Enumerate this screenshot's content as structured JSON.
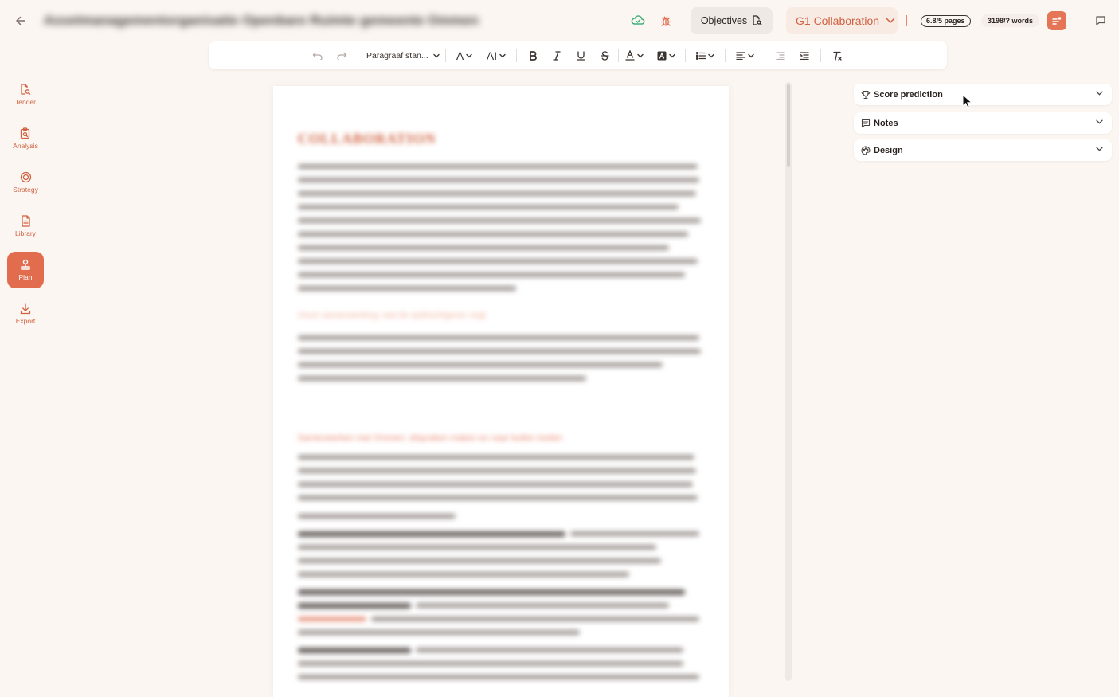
{
  "topbar": {
    "title": "Assetmanagementorganisatie Openbare Ruimte gemeente Ommen",
    "objectives_label": "Objectives",
    "section_label": "G1 Collaboration",
    "pages_badge": "6.8/5 pages",
    "words_badge": "3198/? words"
  },
  "toolbar": {
    "paragraph_style": "Paragraaf stan...",
    "font_size_glyph": "A",
    "line_height_glyph": "AI"
  },
  "nav": {
    "items": [
      {
        "label": "Tender",
        "icon": "tender-icon"
      },
      {
        "label": "Analysis",
        "icon": "analysis-icon"
      },
      {
        "label": "Strategy",
        "icon": "target-icon"
      },
      {
        "label": "Library",
        "icon": "document-icon"
      },
      {
        "label": "Plan",
        "icon": "plan-icon",
        "active": true
      },
      {
        "label": "Export",
        "icon": "download-icon"
      }
    ]
  },
  "document": {
    "heading": "COLLABORATION",
    "subheading_1": "Onze samenwerking: wat de opdrachtgever zegt",
    "subheading_2": "Samenwerken met Ommen: afspraken maken en naar buiten treden"
  },
  "panel": {
    "items": [
      {
        "title": "Score prediction",
        "icon": "trophy-icon"
      },
      {
        "title": "Notes",
        "icon": "notes-icon"
      },
      {
        "title": "Design",
        "icon": "palette-icon"
      }
    ]
  },
  "colors": {
    "accent": "#e16d4e",
    "accent_text": "#d0613f",
    "background": "#fbf6f2",
    "success": "#3fae7a"
  }
}
